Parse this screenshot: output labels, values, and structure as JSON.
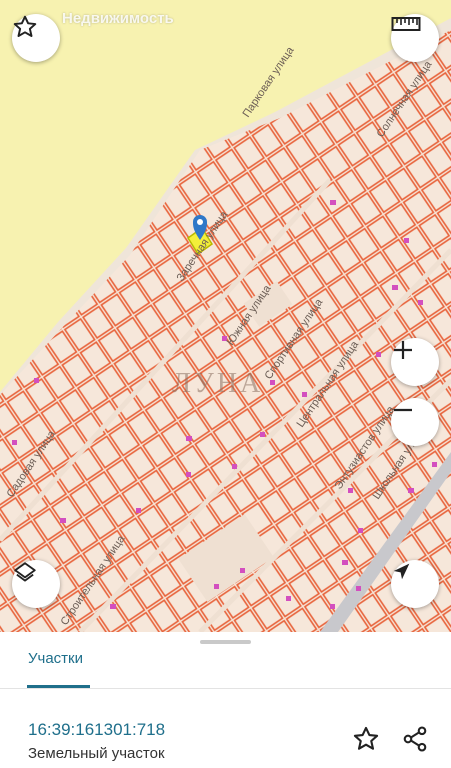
{
  "app": {
    "title": "Недвижимость"
  },
  "map": {
    "streets": [
      "Парковая улица",
      "Солнечная улица",
      "Заречная улица",
      "Южная улица",
      "Спортивная улица",
      "Центральная улица",
      "Энтузиастов улица",
      "Школьная улица",
      "Садовая улица",
      "Строительная улица"
    ],
    "watermark": "ЛУНА",
    "colors": {
      "forest": "#f5f0a8",
      "parcel_fill": "#f6e7da",
      "parcel_stroke": "#e8623a",
      "selected": "#f3ef3a",
      "building": "#d34fbf"
    }
  },
  "controls": {
    "favorite_icon": "star-icon",
    "ruler_icon": "ruler-icon",
    "zoom_in_icon": "plus-icon",
    "zoom_out_icon": "minus-icon",
    "layers_icon": "layers-icon",
    "locate_icon": "navigation-arrow-icon"
  },
  "sheet": {
    "tab_label": "Участки",
    "cadastral_number": "16:39:161301:718",
    "type": "Земельный участок"
  }
}
